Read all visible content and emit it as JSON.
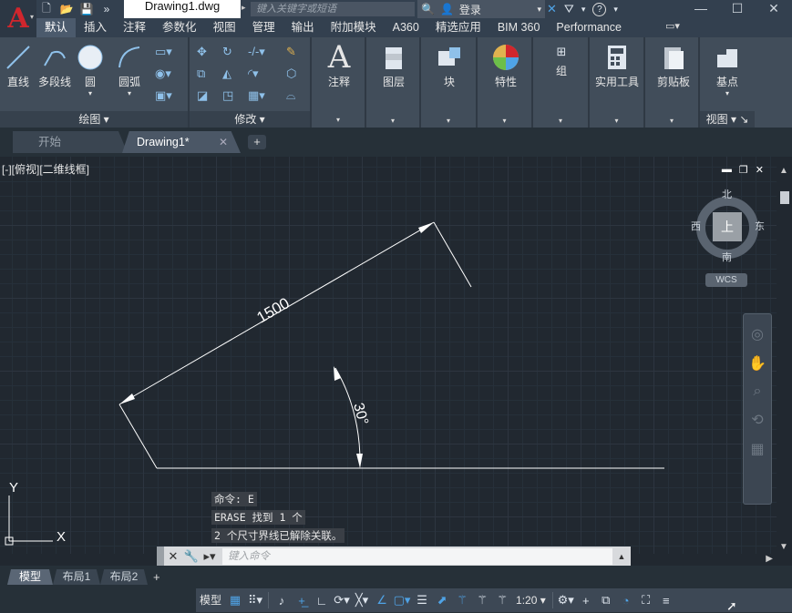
{
  "titlebar": {
    "doc_title": "Drawing1.dwg",
    "search_placeholder": "键入关键字或短语",
    "login_label": "登录",
    "help_icon": "?"
  },
  "ribbon": {
    "tabs": [
      "默认",
      "插入",
      "注释",
      "参数化",
      "视图",
      "管理",
      "输出",
      "附加模块",
      "A360",
      "精选应用",
      "BIM 360",
      "Performance"
    ],
    "active_tab": "默认",
    "draw_panel": {
      "label": "绘图",
      "buttons": [
        "直线",
        "多段线",
        "圆",
        "圆弧"
      ]
    },
    "modify_panel": {
      "label": "修改"
    },
    "big_buttons": [
      "注释",
      "图层",
      "块",
      "特性",
      "组",
      "实用工具",
      "剪贴板",
      "基点"
    ],
    "view_panel": {
      "label": "视图"
    }
  },
  "filetabs": {
    "start": "开始",
    "drawing": "Drawing1*"
  },
  "viewport": {
    "label": "[-][俯视][二维线框]",
    "dimension_text": "1500",
    "angle_text": "30°",
    "ucs_x": "X",
    "ucs_y": "Y"
  },
  "viewcube": {
    "north": "北",
    "south": "南",
    "east": "东",
    "west": "西",
    "face": "上",
    "wcs": "WCS"
  },
  "command": {
    "history": [
      "命令: E",
      "ERASE 找到 1 个",
      "2 个尺寸界线已解除关联。"
    ],
    "placeholder": "键入命令"
  },
  "layout_tabs": [
    "模型",
    "布局1",
    "布局2"
  ],
  "statusbar": {
    "model": "模型",
    "scale": "1:20"
  },
  "colors": {
    "background": "#212830",
    "ribbon": "#414d5a",
    "accent": "#4fa3e6",
    "logo_red": "#d0262d"
  }
}
